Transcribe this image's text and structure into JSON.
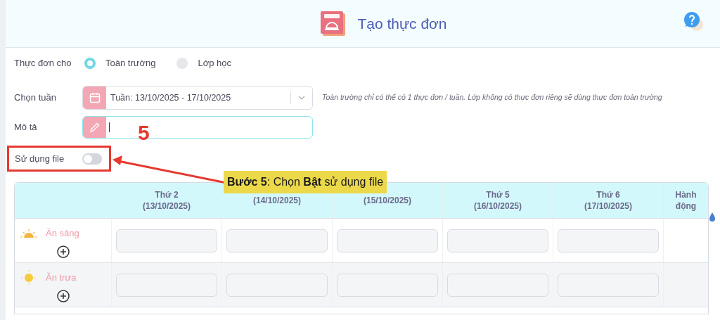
{
  "header": {
    "title": "Tạo thực đơn"
  },
  "audience": {
    "label": "Thực đơn cho",
    "options": [
      {
        "label": "Toàn trường",
        "selected": true
      },
      {
        "label": "Lớp học",
        "selected": false
      }
    ]
  },
  "week": {
    "label": "Chọn tuần",
    "value": "Tuần: 13/10/2025 - 17/10/2025",
    "hint": "Toàn trường chỉ có thể có 1 thực đơn / tuần. Lớp không có thực đơn riêng sẽ dùng thực đơn toàn trường"
  },
  "description": {
    "label": "Mô tả"
  },
  "use_file": {
    "label": "Sử dụng file",
    "on": false
  },
  "table": {
    "columns": [
      {
        "day": "Thứ 2",
        "date": "(13/10/2025)"
      },
      {
        "date": "(14/10/2025)"
      },
      {
        "date": "(15/10/2025)"
      },
      {
        "day": "Thứ 5",
        "date": "(16/10/2025)"
      },
      {
        "day": "Thứ 6",
        "date": "(17/10/2025)"
      }
    ],
    "action_header": "Hành động",
    "rows": [
      {
        "meal": "Ăn sáng",
        "kind": "sunrise"
      },
      {
        "meal": "Ăn trưa",
        "kind": "sun"
      }
    ]
  },
  "annotation": {
    "step_number": "5",
    "callout": "**Bước 5**: Chọn **Bật** sử dụng file"
  }
}
